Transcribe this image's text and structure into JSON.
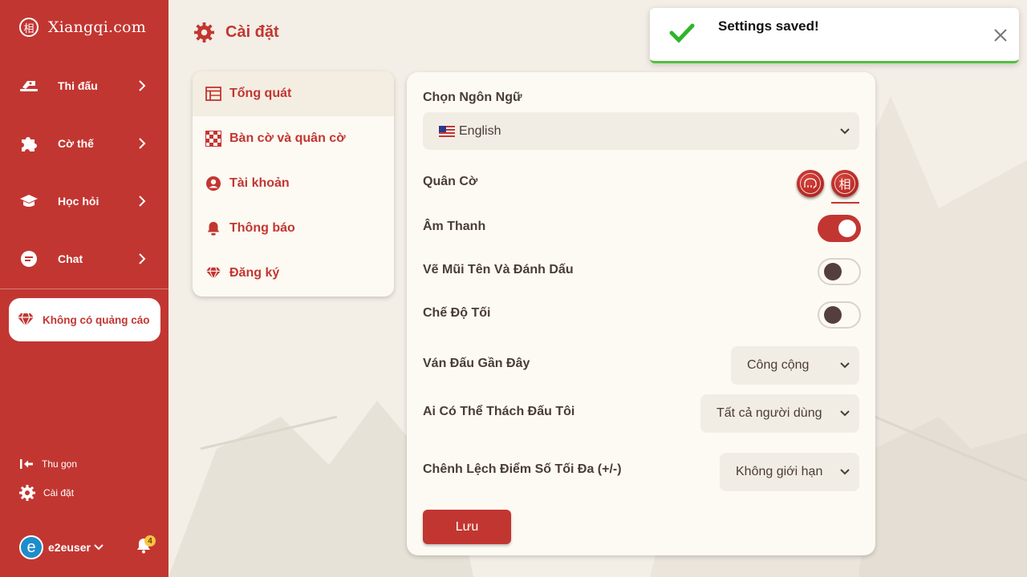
{
  "app": {
    "logo_glyph": "相",
    "logo_text": "Xiangqi.com"
  },
  "sidebar": {
    "items": [
      {
        "label": "Thi đấu",
        "icon": "play-icon"
      },
      {
        "label": "Cờ thế",
        "icon": "puzzle-icon"
      },
      {
        "label": "Học hỏi",
        "icon": "graduation-cap-icon"
      },
      {
        "label": "Chat",
        "icon": "chat-icon"
      }
    ],
    "no_ads_label": "Không có quảng cáo",
    "collapse_label": "Thu gọn",
    "settings_label": "Cài đặt",
    "user": {
      "avatar_letter": "e",
      "name": "e2euser"
    },
    "notification_count": "4"
  },
  "page": {
    "title": "Cài đặt"
  },
  "settings_menu": [
    {
      "label": "Tổng quát",
      "icon": "layout-icon",
      "active": true
    },
    {
      "label": "Bàn cờ và quân cờ",
      "icon": "board-icon",
      "active": false
    },
    {
      "label": "Tài khoản",
      "icon": "account-icon",
      "active": false
    },
    {
      "label": "Thông báo",
      "icon": "bell-icon",
      "active": false
    },
    {
      "label": "Đăng ký",
      "icon": "diamond-icon",
      "active": false
    }
  ],
  "panel": {
    "language_label": "Chọn Ngôn Ngữ",
    "language_value": "English",
    "pieces_label": "Quân Cờ",
    "pieces_selected": "traditional",
    "piece_traditional_glyph": "相",
    "sound_label": "Âm Thanh",
    "sound_on": true,
    "arrows_label": "Vẽ Mũi Tên Và Đánh Dấu",
    "arrows_on": false,
    "dark_label": "Chế Độ Tối",
    "dark_on": false,
    "recent_games_label": "Ván Đấu Gần Đây",
    "recent_games_value": "Công cộng",
    "challenge_label": "Ai Có Thể Thách Đấu Tôi",
    "challenge_value": "Tất cả người dùng",
    "rating_diff_label": "Chênh Lệch Điểm Số Tối Đa (+/-)",
    "rating_diff_value": "Không giới hạn",
    "save_label": "Lưu"
  },
  "toast": {
    "message": "Settings saved!",
    "type": "success"
  },
  "colors": {
    "brand": "#c23631",
    "success": "#4fc13c",
    "panel_bg": "#fdfaf3"
  }
}
